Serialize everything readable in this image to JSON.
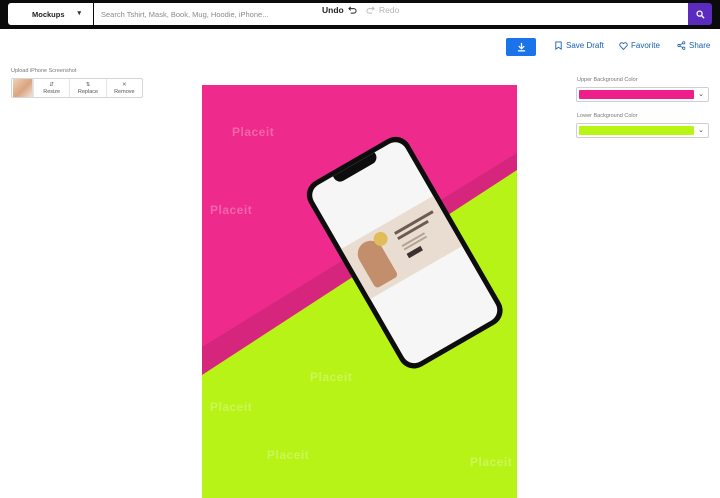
{
  "header": {
    "category": "Mockups",
    "search_placeholder": "Search Tshirt, Mask, Book, Mug, Hoodie, iPhone..."
  },
  "actions": {
    "undo": "Undo",
    "redo": "Redo",
    "save_draft": "Save Draft",
    "favorite": "Favorite",
    "share": "Share"
  },
  "upload": {
    "label": "Upload iPhone Screenshot",
    "resize": "Resize",
    "replace": "Replace",
    "remove": "Remove"
  },
  "colors": {
    "upper_label": "Upper Background Color",
    "upper_value": "#ee1f8b",
    "lower_label": "Lower Background Color",
    "lower_value": "#b8f514"
  },
  "canvas": {
    "top_color": "#ee2a8c",
    "bottom_color": "#b7f317",
    "watermark": "Placeit"
  },
  "icons": {
    "search": "search-icon",
    "undo": "undo-icon",
    "redo": "redo-icon",
    "download": "download-icon",
    "save": "save-icon",
    "heart": "heart-icon",
    "share": "share-icon"
  }
}
